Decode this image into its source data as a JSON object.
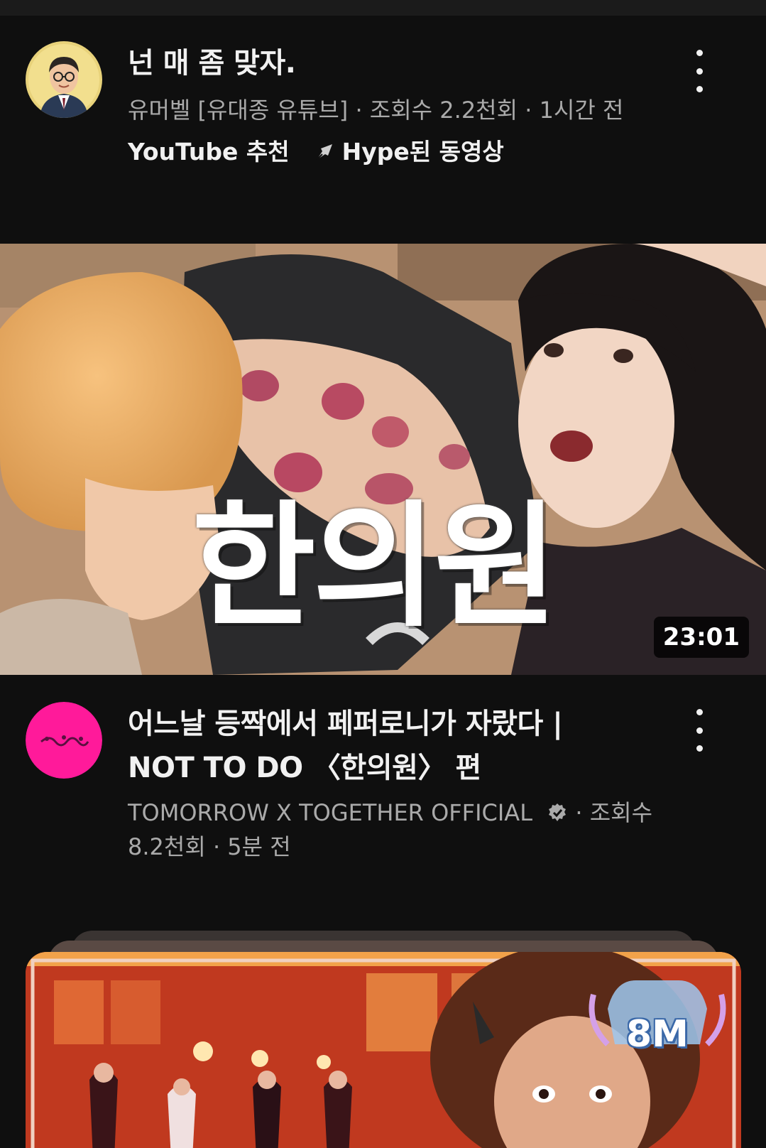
{
  "video1": {
    "title": "넌 매 좀 맞자.",
    "channel": "유머벨 [유대종 유튜브]",
    "views": "조회수 2.2천회",
    "age": "1시간 전",
    "badge_recommended": "YouTube 추천",
    "badge_hype": "Hype된 동영상"
  },
  "video2": {
    "thumbnail_caption": "한의원",
    "duration": "23:01",
    "title_line1": "어느날 등짝에서 페퍼로니가 자랐다 |",
    "title_line2": "NOT TO DO 〈한의원〉 편",
    "channel": "TOMORROW X TOGETHER OFFICIAL",
    "views_label": "조회수",
    "views_count": "8.2천회",
    "age": "5분 전"
  },
  "video3": {
    "view_badge": "8M"
  },
  "colors": {
    "background": "#0f0f0f",
    "primary_text": "#f1f1f1",
    "secondary_text": "#aaaaaa",
    "channel_avatar_pink": "#ff1493"
  },
  "icons": [
    "more-vert-icon",
    "hype-icon",
    "verified-icon"
  ]
}
